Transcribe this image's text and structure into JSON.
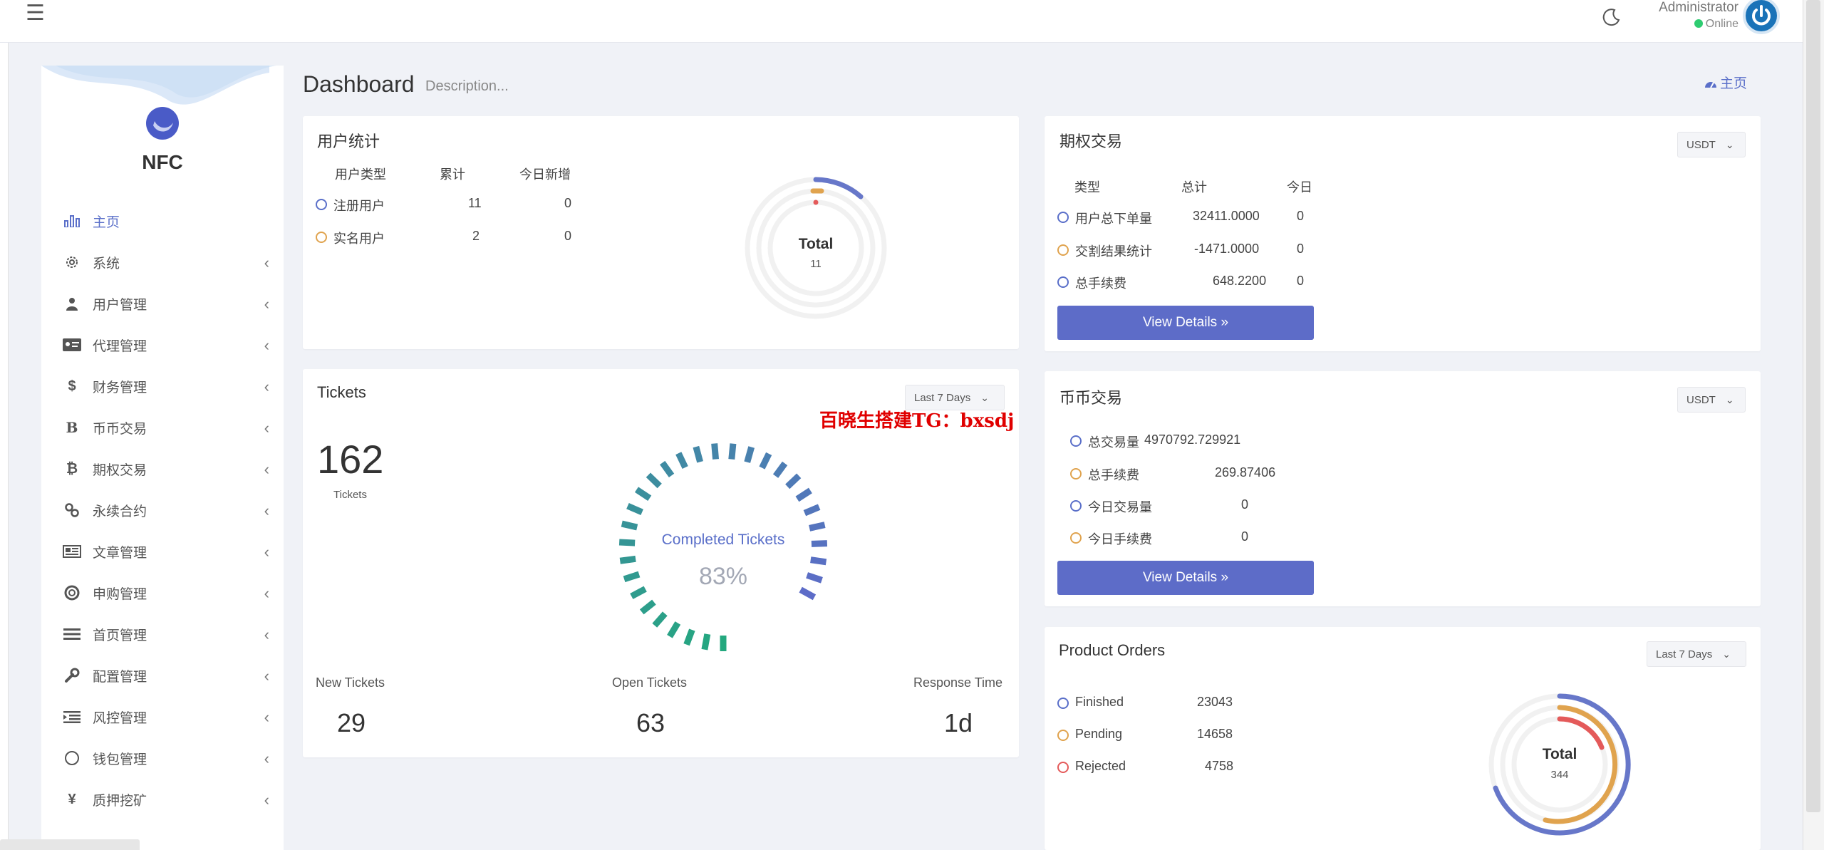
{
  "header": {
    "admin_name": "Administrator",
    "status": "Online",
    "icons": [
      "menu-icon",
      "moon-icon",
      "power-icon"
    ]
  },
  "sidebar": {
    "brand": "NFC",
    "items": [
      {
        "label": "主页",
        "icon": "bar-chart-icon",
        "active": true
      },
      {
        "label": "系统",
        "icon": "gear-icon"
      },
      {
        "label": "用户管理",
        "icon": "user-tie-icon"
      },
      {
        "label": "代理管理",
        "icon": "id-card-icon"
      },
      {
        "label": "财务管理",
        "icon": "dollar-icon"
      },
      {
        "label": "币币交易",
        "icon": "letter-b-icon"
      },
      {
        "label": "期权交易",
        "icon": "bitcoin-icon"
      },
      {
        "label": "永续合约",
        "icon": "link-icon"
      },
      {
        "label": "文章管理",
        "icon": "newspaper-icon"
      },
      {
        "label": "申购管理",
        "icon": "lifebuoy-icon"
      },
      {
        "label": "首页管理",
        "icon": "list-icon"
      },
      {
        "label": "配置管理",
        "icon": "wrench-icon"
      },
      {
        "label": "风控管理",
        "icon": "indent-icon"
      },
      {
        "label": "钱包管理",
        "icon": "circle-icon"
      },
      {
        "label": "质押挖矿",
        "icon": "yen-icon"
      }
    ]
  },
  "page": {
    "title": "Dashboard",
    "description": "Description...",
    "home_link": "主页"
  },
  "user_stats": {
    "title": "用户统计",
    "headers": [
      "用户类型",
      "累计",
      "今日新增"
    ],
    "rows": [
      {
        "type": "注册用户",
        "total": "11",
        "today": "0"
      },
      {
        "type": "实名用户",
        "total": "2",
        "today": "0"
      }
    ],
    "donut_label": "Total",
    "donut_value": "11"
  },
  "options_trading": {
    "title": "期权交易",
    "currency": "USDT",
    "headers": [
      "类型",
      "总计",
      "今日"
    ],
    "rows": [
      {
        "type": "用户总下单量",
        "total": "32411.0000",
        "today": "0"
      },
      {
        "type": "交割结果统计",
        "total": "-1471.0000",
        "today": "0"
      },
      {
        "type": "总手续费",
        "total": "648.2200",
        "today": "0"
      }
    ],
    "button": "View Details »"
  },
  "tickets": {
    "title": "Tickets",
    "period": "Last 7 Days",
    "count": "162",
    "count_label": "Tickets",
    "gauge_label": "Completed Tickets",
    "gauge_value": "83%",
    "stats": [
      {
        "label": "New Tickets",
        "value": "29"
      },
      {
        "label": "Open Tickets",
        "value": "63"
      },
      {
        "label": "Response Time",
        "value": "1d"
      }
    ]
  },
  "coin_trading": {
    "title": "币币交易",
    "currency": "USDT",
    "rows": [
      {
        "label": "总交易量",
        "value": "4970792.729921"
      },
      {
        "label": "总手续费",
        "value": "269.87406"
      },
      {
        "label": "今日交易量",
        "value": "0"
      },
      {
        "label": "今日手续费",
        "value": "0"
      }
    ],
    "button": "View Details »"
  },
  "product_orders": {
    "title": "Product Orders",
    "period": "Last 7 Days",
    "rows": [
      {
        "label": "Finished",
        "value": "23043"
      },
      {
        "label": "Pending",
        "value": "14658"
      },
      {
        "label": "Rejected",
        "value": "4758"
      }
    ],
    "donut_label": "Total",
    "donut_value": "344"
  },
  "watermark": "百晓生搭建TG：bxsdj",
  "colors": {
    "accent": "#5a6fc9",
    "button": "#5d6cc8",
    "orange": "#e0a34e",
    "red": "#e45a5a",
    "green": "#23a87e"
  }
}
